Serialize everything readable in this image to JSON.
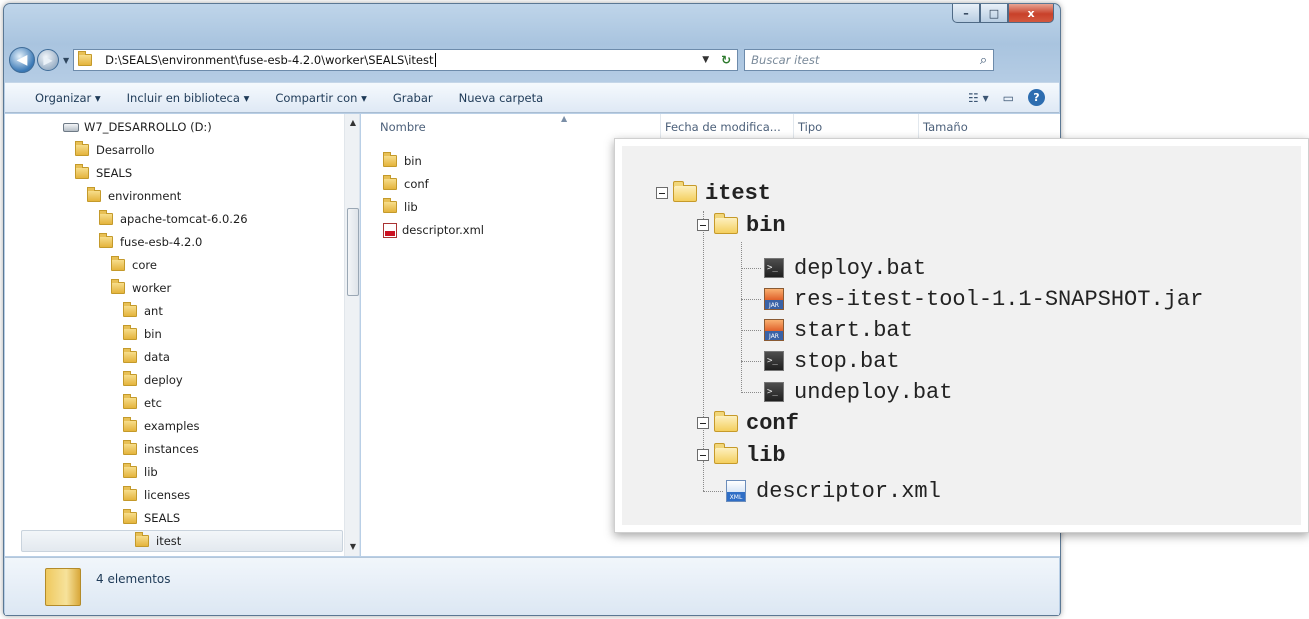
{
  "window": {
    "minimize": "–",
    "maximize": "□",
    "close": "x"
  },
  "address": {
    "path": "D:\\SEALS\\environment\\fuse-esb-4.2.0\\worker\\SEALS\\itest",
    "search_placeholder": "Buscar itest"
  },
  "toolbar": {
    "organize": "Organizar ▾",
    "include_library": "Incluir en biblioteca ▾",
    "share_with": "Compartir con ▾",
    "burn": "Grabar",
    "new_folder": "Nueva carpeta"
  },
  "nav_tree": [
    "W7_DESARROLLO (D:)",
    "Desarrollo",
    "SEALS",
    "environment",
    "apache-tomcat-6.0.26",
    "fuse-esb-4.2.0",
    "core",
    "worker",
    "ant",
    "bin",
    "data",
    "deploy",
    "etc",
    "examples",
    "instances",
    "lib",
    "licenses",
    "SEALS",
    "itest"
  ],
  "columns": {
    "name": "Nombre",
    "date": "Fecha de modifica...",
    "type": "Tipo",
    "size": "Tamaño"
  },
  "files": [
    "bin",
    "conf",
    "lib",
    "descriptor.xml"
  ],
  "status": {
    "count": "4 elementos"
  },
  "overlay_tree": {
    "root": "itest",
    "bin": "bin",
    "bin_files": [
      "deploy.bat",
      "res-itest-tool-1.1-SNAPSHOT.jar",
      "start.bat",
      "stop.bat",
      "undeploy.bat"
    ],
    "conf": "conf",
    "lib": "lib",
    "descriptor": "descriptor.xml",
    "jar_badge": "JAR",
    "xml_badge": "XML",
    "bat_badge": ">_"
  }
}
